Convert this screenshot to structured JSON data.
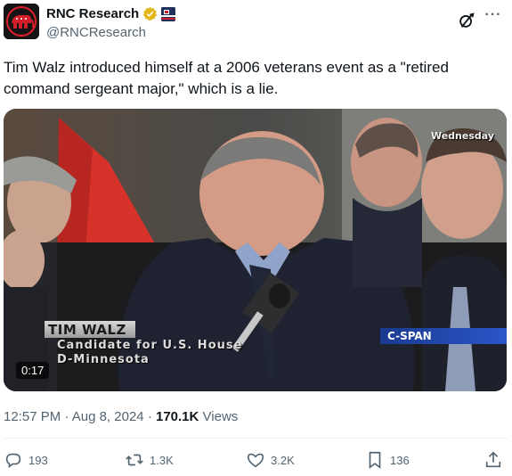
{
  "header": {
    "display_name": "RNC Research",
    "handle": "@RNCResearch",
    "icons": [
      "gop-elephant-avatar",
      "verified-badge-icon",
      "affiliate-flag-icon",
      "grok-icon",
      "more-icon"
    ]
  },
  "tweet": {
    "text": "Tim Walz introduced himself at a 2006 veterans event as a \"retired command sergeant major,\" which is a lie."
  },
  "video": {
    "overlay_day": "Wednesday",
    "lower_third_name": "TIM WALZ",
    "lower_third_line1": "Candidate for U.S. House",
    "lower_third_line2": "D-Minnesota",
    "network": "C-SPAN",
    "duration": "0:17"
  },
  "meta": {
    "time": "12:57 PM",
    "separator": "·",
    "date": "Aug 8, 2024",
    "views_count": "170.1K",
    "views_label": "Views"
  },
  "actions": {
    "replies": "193",
    "reposts": "1.3K",
    "likes": "3.2K",
    "bookmarks": "136"
  },
  "colors": {
    "text": "#0f1419",
    "secondary": "#536471",
    "verified": "#e2b719",
    "divider": "#eff3f4"
  }
}
